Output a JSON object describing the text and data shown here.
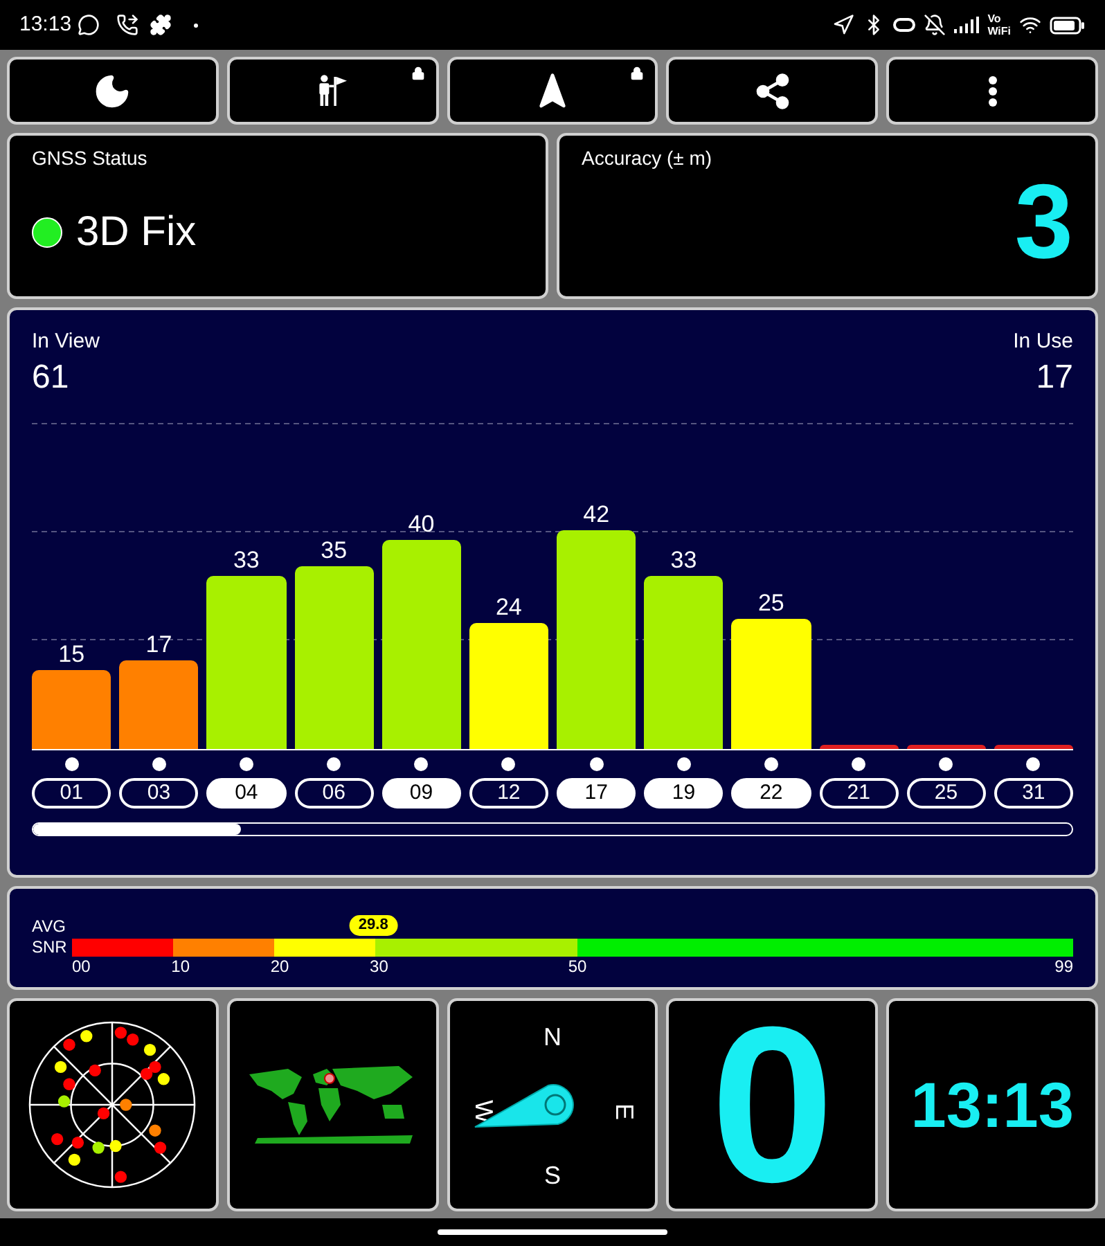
{
  "status_bar": {
    "time": "13:13",
    "network_label": [
      "Vo",
      "WiFi"
    ]
  },
  "toolbar": [
    {
      "kind": "night",
      "locked": false
    },
    {
      "kind": "guide",
      "locked": true
    },
    {
      "kind": "navigate",
      "locked": true
    },
    {
      "kind": "share",
      "locked": false
    },
    {
      "kind": "menu",
      "locked": false
    }
  ],
  "gnss_status": {
    "label": "GNSS Status",
    "value": "3D Fix",
    "color": "#22ee22"
  },
  "accuracy": {
    "label": "Accuracy (± m)",
    "value": "3"
  },
  "satellites_panel": {
    "in_view_label": "In View",
    "in_view": "61",
    "in_use_label": "In Use",
    "in_use": "17",
    "chart_data": {
      "type": "bar",
      "categories": [
        "01",
        "03",
        "04",
        "06",
        "09",
        "12",
        "17",
        "19",
        "22",
        "21",
        "25",
        "31"
      ],
      "values": [
        15,
        17,
        33,
        35,
        40,
        24,
        42,
        33,
        25,
        0,
        0,
        0
      ],
      "value_labels": [
        "15",
        "17",
        "33",
        "35",
        "40",
        "24",
        "42",
        "33",
        "25",
        null,
        null,
        null
      ]
    },
    "satellites": [
      {
        "color": "#ff8000",
        "selected": false
      },
      {
        "color": "#ff8000",
        "selected": false
      },
      {
        "color": "#a8f000",
        "selected": true
      },
      {
        "color": "#a8f000",
        "selected": false
      },
      {
        "color": "#a8f000",
        "selected": true
      },
      {
        "color": "#ffff00",
        "selected": false
      },
      {
        "color": "#a8f000",
        "selected": true
      },
      {
        "color": "#a8f000",
        "selected": true
      },
      {
        "color": "#ffff00",
        "selected": true
      },
      {
        "color": "#e02020",
        "selected": false
      },
      {
        "color": "#e02020",
        "selected": false
      },
      {
        "color": "#e02020",
        "selected": false
      }
    ],
    "scroll_bar": true
  },
  "snr": {
    "avg_label": "AVG",
    "snr_label": "SNR",
    "value": "29.8",
    "level": 0.301,
    "segments": [
      {
        "label": "00",
        "color": "#ff0000"
      },
      {
        "label": "10",
        "color": "#ff8000"
      },
      {
        "label": "20",
        "color": "#ffff00"
      },
      {
        "label": "30",
        "color": "#a8f000"
      },
      {
        "label": "50",
        "color": "#00ee00"
      }
    ],
    "end_label": "99"
  },
  "tiles": [
    {
      "kind": "skyplot"
    },
    {
      "kind": "map"
    },
    {
      "kind": "compass",
      "letters": [
        "N",
        "E",
        "S",
        "W"
      ]
    },
    {
      "kind": "speed",
      "value": "0"
    },
    {
      "kind": "clock",
      "value": "13:13"
    }
  ]
}
